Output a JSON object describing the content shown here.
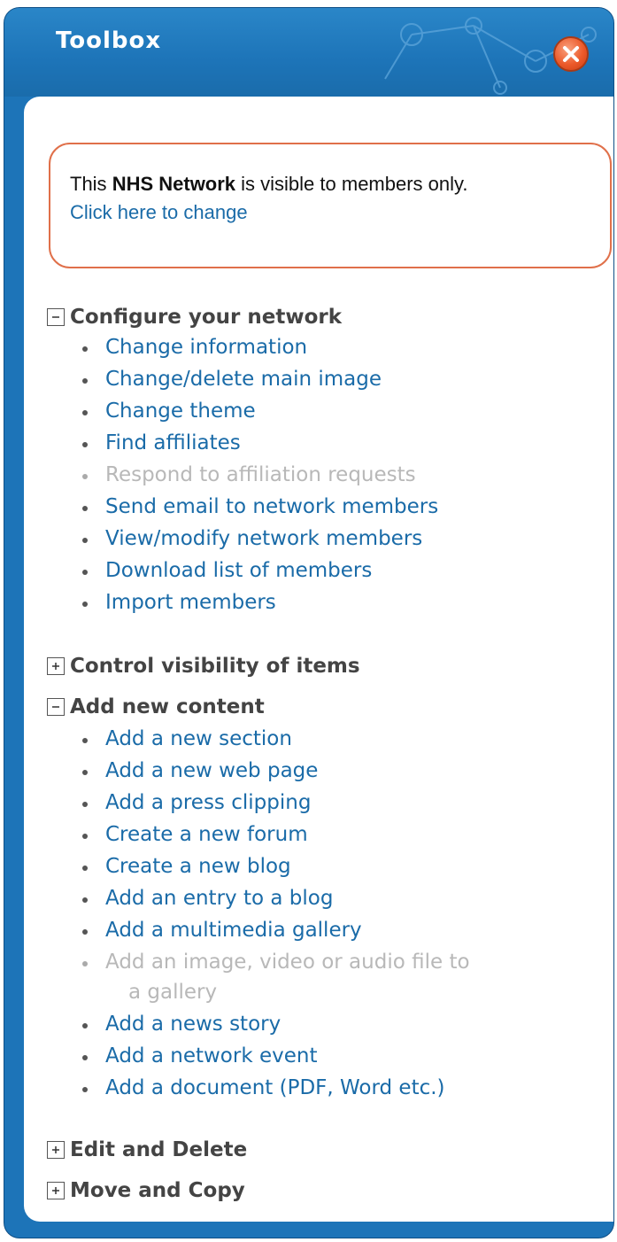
{
  "window": {
    "title": "Toolbox",
    "close_icon": "close-icon"
  },
  "notice": {
    "prefix": "This ",
    "bold": "NHS Network",
    "suffix": " is visible to members only.",
    "link": "Click here to change"
  },
  "sections": {
    "configure": {
      "title": "Configure your network",
      "state": "expanded",
      "items": [
        {
          "label": "Change information",
          "enabled": true
        },
        {
          "label": "Change/delete main image",
          "enabled": true
        },
        {
          "label": "Change theme",
          "enabled": true
        },
        {
          "label": "Find affiliates",
          "enabled": true
        },
        {
          "label": "Respond to affiliation requests",
          "enabled": false
        },
        {
          "label": "Send email to network members",
          "enabled": true
        },
        {
          "label": "View/modify network members",
          "enabled": true
        },
        {
          "label": "Download list of members",
          "enabled": true
        },
        {
          "label": "Import members",
          "enabled": true
        }
      ]
    },
    "visibility": {
      "title": "Control visibility of items",
      "state": "collapsed"
    },
    "add_content": {
      "title": "Add new content",
      "state": "expanded",
      "items": [
        {
          "label": "Add a new section",
          "enabled": true
        },
        {
          "label": "Add a new web page",
          "enabled": true
        },
        {
          "label": "Add a press clipping",
          "enabled": true
        },
        {
          "label": "Create a new forum",
          "enabled": true
        },
        {
          "label": "Create a new blog",
          "enabled": true
        },
        {
          "label": "Add an entry to a blog",
          "enabled": true
        },
        {
          "label": "Add a multimedia gallery",
          "enabled": true
        },
        {
          "label": "Add an image, video or audio file to",
          "enabled": false
        },
        {
          "label": "Add a news story",
          "enabled": true
        },
        {
          "label": "Add a network event",
          "enabled": true
        },
        {
          "label": "Add a document (PDF, Word etc.)",
          "enabled": true
        }
      ],
      "wrapped_line": "a gallery"
    },
    "edit_delete": {
      "title": "Edit and Delete",
      "state": "collapsed"
    },
    "move_copy": {
      "title": "Move and Copy",
      "state": "collapsed"
    }
  },
  "colors": {
    "frame": "#1d74b8",
    "link": "#1a6ba8",
    "disabled": "#b8b8b8",
    "notice_border": "#e0704a",
    "close": "#ec5a2a"
  }
}
